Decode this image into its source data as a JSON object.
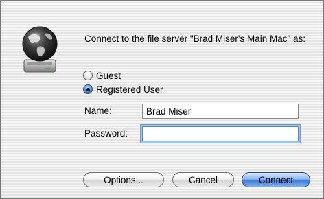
{
  "dialog": {
    "prompt": "Connect to the file server \"Brad Miser's Main Mac\" as:"
  },
  "options": {
    "guest_label": "Guest",
    "registered_label": "Registered User",
    "selected": "Registered User"
  },
  "fields": {
    "name_label": "Name:",
    "name_value": "Brad Miser",
    "password_label": "Password:",
    "password_value": ""
  },
  "buttons": {
    "options": "Options...",
    "cancel": "Cancel",
    "connect": "Connect"
  },
  "icons": {
    "server": "file-server-globe-icon"
  },
  "colors": {
    "default_button": "#3f7bd4",
    "focus_ring": "#6e9bd6"
  }
}
